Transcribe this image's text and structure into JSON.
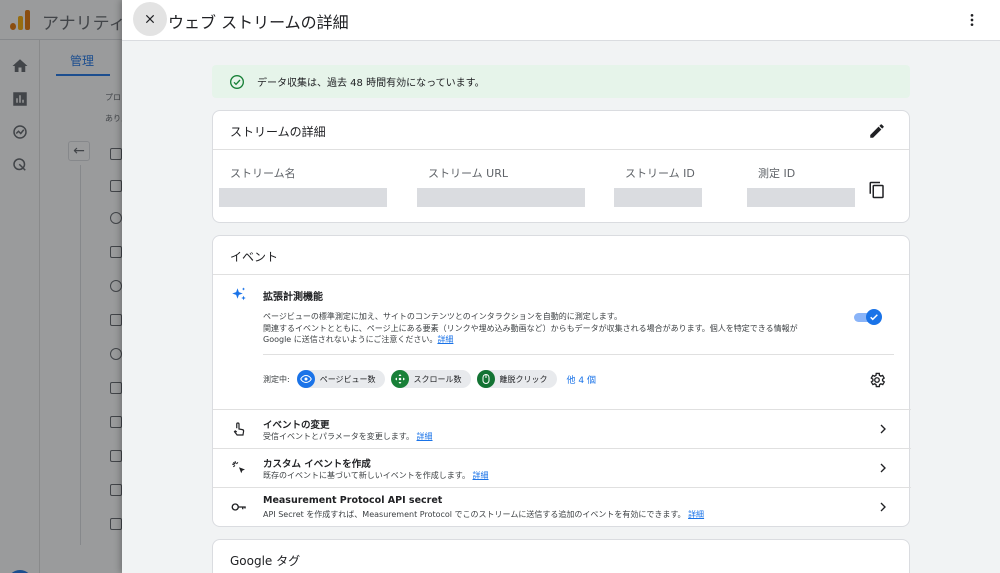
{
  "background_app": {
    "title": "アナリティ",
    "tab_label": "管理",
    "small_text_1": "プロ",
    "small_text_2": "ありん"
  },
  "drawer": {
    "title": "ウェブ ストリームの詳細",
    "close_icon": "close-icon",
    "more_icon": "more-vert-icon"
  },
  "banner": {
    "icon": "check-circle-icon",
    "text": "データ収集は、過去 48 時間有効になっています。"
  },
  "stream_details": {
    "title": "ストリームの詳細",
    "edit_icon": "edit-icon",
    "fields": [
      {
        "label": "ストリーム名",
        "value": ""
      },
      {
        "label": "ストリーム URL",
        "value": ""
      },
      {
        "label": "ストリーム ID",
        "value": ""
      },
      {
        "label": "測定 ID",
        "value": ""
      }
    ],
    "copy_icon": "copy-icon"
  },
  "events": {
    "title": "イベント",
    "enhanced": {
      "title": "拡張計測機能",
      "desc_line1": "ページビューの標準測定に加え、サイトのコンテンツとのインタラクションを自動的に測定します。",
      "desc_line2": "関連するイベントとともに、ページ上にある要素（リンクや埋め込み動画など）からもデータが収集される場合があります。個人を特定できる情報が",
      "desc_line3": "Google に送信されないようにご注意ください。",
      "desc_link": "詳細",
      "toggle_on": true,
      "measuring_label": "測定中:",
      "chips": [
        {
          "label": "ページビュー数",
          "icon": "eye-icon"
        },
        {
          "label": "スクロール数",
          "icon": "scroll-arrows-icon"
        },
        {
          "label": "離脱クリック",
          "icon": "mouse-icon"
        }
      ],
      "more_link": "他 4 個"
    },
    "rows": [
      {
        "title": "イベントの変更",
        "desc": "受信イベントとパラメータを変更します。",
        "link": "詳細",
        "icon": "touch-icon"
      },
      {
        "title": "カスタム イベントを作成",
        "desc": "既存のイベントに基づいて新しいイベントを作成します。",
        "link": "詳細",
        "icon": "sparkle-click-icon"
      },
      {
        "title": "Measurement Protocol API secret",
        "desc": "API Secret を作成すれば、Measurement Protocol でこのストリームに送信する追加のイベントを有効にできます。",
        "link": "詳細",
        "icon": "key-icon"
      }
    ]
  },
  "google_tag": {
    "title": "Google タグ"
  },
  "colors": {
    "accent": "#1a73e8",
    "banner_bg": "#e6f4ea",
    "success": "#188038"
  }
}
